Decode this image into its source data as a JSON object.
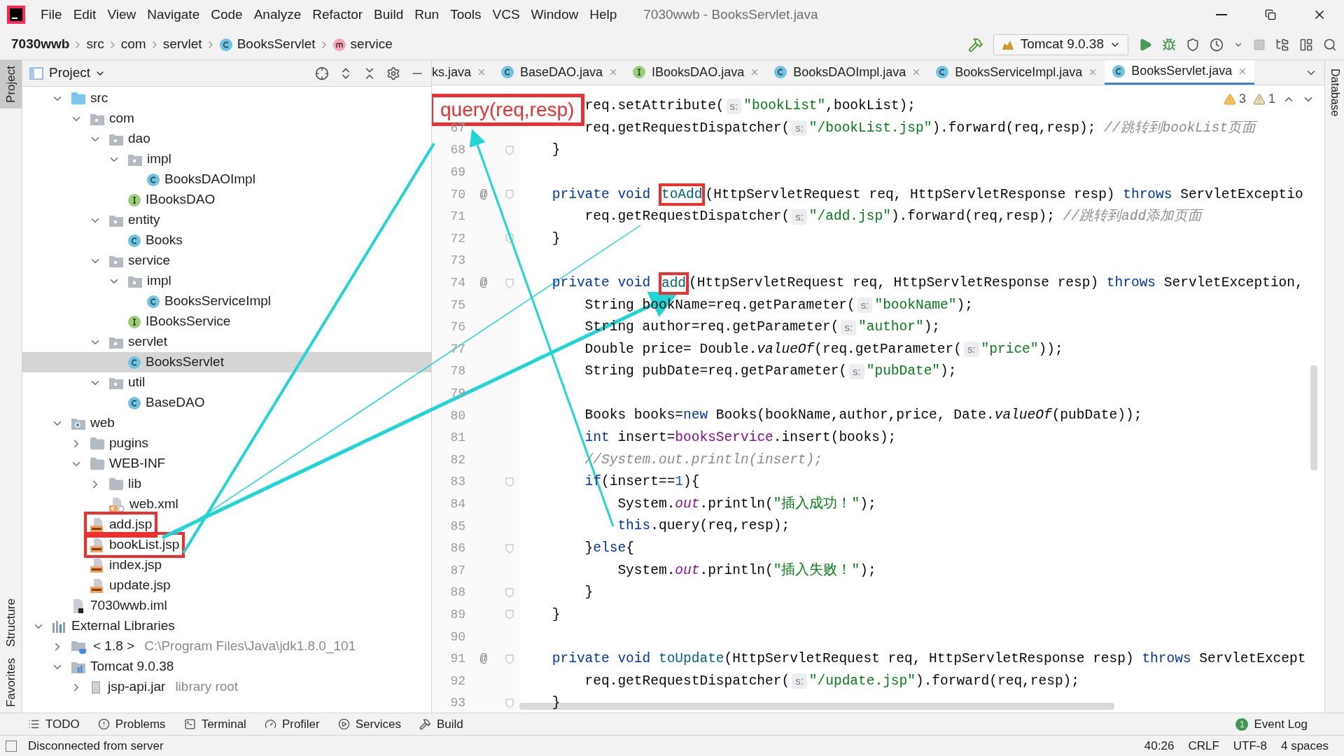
{
  "window": {
    "title": "7030wwb - BooksServlet.java"
  },
  "menu": [
    "File",
    "Edit",
    "View",
    "Navigate",
    "Code",
    "Analyze",
    "Refactor",
    "Build",
    "Run",
    "Tools",
    "VCS",
    "Window",
    "Help"
  ],
  "breadcrumb": [
    {
      "label": "7030wwb",
      "kind": "project"
    },
    {
      "label": "src",
      "kind": "folder"
    },
    {
      "label": "com",
      "kind": "folder"
    },
    {
      "label": "servlet",
      "kind": "folder"
    },
    {
      "label": "BooksServlet",
      "kind": "class"
    },
    {
      "label": "service",
      "kind": "method"
    }
  ],
  "run_config": {
    "label": "Tomcat 9.0.38"
  },
  "side_tabs_left": [
    {
      "label": "Project",
      "selected": true
    },
    {
      "label": "Structure",
      "selected": false
    },
    {
      "label": "Favorites",
      "selected": false
    }
  ],
  "side_tabs_right": [
    {
      "label": "Database",
      "selected": false
    }
  ],
  "project_panel": {
    "title": "Project",
    "root_children": [
      {
        "label": "src",
        "kind": "source-root",
        "expanded": true,
        "selected": false,
        "marked": false,
        "children": [
          {
            "label": "com",
            "kind": "package",
            "expanded": true,
            "selected": false,
            "marked": false,
            "children": [
              {
                "label": "dao",
                "kind": "package",
                "expanded": true,
                "selected": false,
                "marked": false,
                "children": [
                  {
                    "label": "impl",
                    "kind": "package",
                    "expanded": true,
                    "selected": false,
                    "marked": false,
                    "children": [
                      {
                        "label": "BooksDAOImpl",
                        "kind": "class",
                        "selected": false,
                        "marked": false
                      }
                    ]
                  },
                  {
                    "label": "IBooksDAO",
                    "kind": "interface",
                    "selected": false,
                    "marked": false
                  }
                ]
              },
              {
                "label": "entity",
                "kind": "package",
                "expanded": true,
                "selected": false,
                "marked": false,
                "children": [
                  {
                    "label": "Books",
                    "kind": "class",
                    "selected": false,
                    "marked": false
                  }
                ]
              },
              {
                "label": "service",
                "kind": "package",
                "expanded": true,
                "selected": false,
                "marked": false,
                "children": [
                  {
                    "label": "impl",
                    "kind": "package",
                    "expanded": true,
                    "selected": false,
                    "marked": false,
                    "children": [
                      {
                        "label": "BooksServiceImpl",
                        "kind": "class",
                        "selected": false,
                        "marked": false
                      }
                    ]
                  },
                  {
                    "label": "IBooksService",
                    "kind": "interface",
                    "selected": false,
                    "marked": false
                  }
                ]
              },
              {
                "label": "servlet",
                "kind": "package",
                "expanded": true,
                "selected": false,
                "marked": false,
                "children": [
                  {
                    "label": "BooksServlet",
                    "kind": "class",
                    "selected": true,
                    "marked": false
                  }
                ]
              },
              {
                "label": "util",
                "kind": "package",
                "expanded": true,
                "selected": false,
                "marked": false,
                "children": [
                  {
                    "label": "BaseDAO",
                    "kind": "class",
                    "selected": false,
                    "marked": false
                  }
                ]
              }
            ]
          }
        ]
      },
      {
        "label": "web",
        "kind": "web-root",
        "expanded": true,
        "selected": false,
        "marked": false,
        "children": [
          {
            "label": "pugins",
            "kind": "folder",
            "expanded": false,
            "selected": false,
            "marked": false
          },
          {
            "label": "WEB-INF",
            "kind": "folder",
            "expanded": true,
            "selected": false,
            "marked": false,
            "children": [
              {
                "label": "lib",
                "kind": "folder",
                "expanded": false,
                "selected": false,
                "marked": false
              },
              {
                "label": "web.xml",
                "kind": "xml",
                "selected": false,
                "marked": false
              }
            ]
          },
          {
            "label": "add.jsp",
            "kind": "jsp",
            "selected": false,
            "marked": true
          },
          {
            "label": "bookList.jsp",
            "kind": "jsp",
            "selected": false,
            "marked": true
          },
          {
            "label": "index.jsp",
            "kind": "jsp",
            "selected": false,
            "marked": false
          },
          {
            "label": "update.jsp",
            "kind": "jsp",
            "selected": false,
            "marked": false
          }
        ]
      },
      {
        "label": "7030wwb.iml",
        "kind": "iml",
        "selected": false,
        "marked": false
      }
    ],
    "external": [
      {
        "label": "External Libraries",
        "kind": "libraries",
        "expanded": true,
        "selected": false,
        "marked": false,
        "children": [
          {
            "label": "< 1.8 >",
            "detail": "C:\\Program Files\\Java\\jdk1.8.0_101",
            "kind": "jdk",
            "expanded": false,
            "selected": false,
            "marked": false
          },
          {
            "label": "Tomcat 9.0.38",
            "kind": "tomcat",
            "expanded": true,
            "selected": false,
            "marked": false,
            "children": [
              {
                "label": "jsp-api.jar",
                "detail": "library root",
                "kind": "jar",
                "expanded": false,
                "selected": false,
                "marked": false
              }
            ]
          }
        ]
      }
    ]
  },
  "tabs": [
    {
      "label": "ks.java",
      "selected": false
    },
    {
      "label": "BaseDAO.java",
      "kind": "class",
      "selected": false
    },
    {
      "label": "IBooksDAO.java",
      "kind": "interface",
      "selected": false
    },
    {
      "label": "BooksDAOImpl.java",
      "kind": "class",
      "selected": false
    },
    {
      "label": "BooksServiceImpl.java",
      "kind": "class",
      "selected": false
    },
    {
      "label": "BooksServlet.java",
      "kind": "class",
      "selected": true
    }
  ],
  "inspections": {
    "warnings": "3",
    "weak_warnings": "1"
  },
  "code": {
    "lines": [
      {
        "tokens": [
          {
            "kind": "plain",
            "t": "        req.setAttribute("
          },
          {
            "kind": "hint",
            "t": "s:"
          },
          {
            "kind": "string",
            "t": "\"bookList\""
          },
          {
            "kind": "plain",
            "t": ",bookList);"
          }
        ]
      },
      {
        "number": "67",
        "tokens": [
          {
            "kind": "plain",
            "t": "        req.getRequestDispatcher("
          },
          {
            "kind": "hint",
            "t": "s:"
          },
          {
            "kind": "string",
            "t": "\"/bookList.jsp\""
          },
          {
            "kind": "plain",
            "t": ").forward(req,resp); "
          },
          {
            "kind": "comment",
            "t": "//跳转到bookList页面"
          }
        ]
      },
      {
        "number": "68",
        "fold": true,
        "tokens": [
          {
            "kind": "plain",
            "t": "    }"
          }
        ]
      },
      {
        "number": "69"
      },
      {
        "number": "70",
        "marker": "@",
        "fold": true,
        "tokens": [
          {
            "kind": "keyword",
            "t": "    private void "
          },
          {
            "kind": "declaration",
            "t": "toAdd",
            "boxed": true
          },
          {
            "kind": "plain",
            "t": "(HttpServletRequest req, HttpServletResponse resp) "
          },
          {
            "kind": "keyword",
            "t": "throws"
          },
          {
            "kind": "plain",
            "t": " ServletExceptio"
          }
        ]
      },
      {
        "number": "71",
        "tokens": [
          {
            "kind": "plain",
            "t": "        req.getRequestDispatcher("
          },
          {
            "kind": "hint",
            "t": "s:"
          },
          {
            "kind": "string",
            "t": "\"/add.jsp\""
          },
          {
            "kind": "plain",
            "t": ").forward(req,resp); "
          },
          {
            "kind": "comment",
            "t": "//跳转到add添加页面"
          }
        ]
      },
      {
        "number": "72",
        "fold": true,
        "tokens": [
          {
            "kind": "plain",
            "t": "    }"
          }
        ]
      },
      {
        "number": "73"
      },
      {
        "number": "74",
        "marker": "@",
        "fold": true,
        "tokens": [
          {
            "kind": "keyword",
            "t": "    private void "
          },
          {
            "kind": "declaration",
            "t": "add",
            "boxed": true
          },
          {
            "kind": "plain",
            "t": "(HttpServletRequest req, HttpServletResponse resp) "
          },
          {
            "kind": "keyword",
            "t": "throws"
          },
          {
            "kind": "plain",
            "t": " ServletException,"
          }
        ]
      },
      {
        "number": "75",
        "tokens": [
          {
            "kind": "plain",
            "t": "        String bookName=req.getParameter("
          },
          {
            "kind": "hint",
            "t": "s:"
          },
          {
            "kind": "string",
            "t": "\"bookName\""
          },
          {
            "kind": "plain",
            "t": ");"
          }
        ]
      },
      {
        "number": "76",
        "tokens": [
          {
            "kind": "plain",
            "t": "        String author=req.getParameter("
          },
          {
            "kind": "hint",
            "t": "s:"
          },
          {
            "kind": "string",
            "t": "\"author\""
          },
          {
            "kind": "plain",
            "t": ");"
          }
        ]
      },
      {
        "number": "77",
        "tokens": [
          {
            "kind": "plain",
            "t": "        Double price= Double."
          },
          {
            "kind": "static-method",
            "t": "valueOf"
          },
          {
            "kind": "plain",
            "t": "(req.getParameter("
          },
          {
            "kind": "hint",
            "t": "s:"
          },
          {
            "kind": "string",
            "t": "\"price\""
          },
          {
            "kind": "plain",
            "t": "));"
          }
        ]
      },
      {
        "number": "78",
        "tokens": [
          {
            "kind": "plain",
            "t": "        String pubDate=req.getParameter("
          },
          {
            "kind": "hint",
            "t": "s:"
          },
          {
            "kind": "string",
            "t": "\"pubDate\""
          },
          {
            "kind": "plain",
            "t": ");"
          }
        ]
      },
      {
        "number": "79"
      },
      {
        "number": "80",
        "tokens": [
          {
            "kind": "plain",
            "t": "        Books books="
          },
          {
            "kind": "keyword",
            "t": "new"
          },
          {
            "kind": "plain",
            "t": " Books(bookName,author,price, Date."
          },
          {
            "kind": "static-method",
            "t": "valueOf"
          },
          {
            "kind": "plain",
            "t": "(pubDate));"
          }
        ]
      },
      {
        "number": "81",
        "tokens": [
          {
            "kind": "keyword",
            "t": "        int"
          },
          {
            "kind": "plain",
            "t": " insert="
          },
          {
            "kind": "field",
            "t": "booksService"
          },
          {
            "kind": "plain",
            "t": ".insert(books);"
          }
        ]
      },
      {
        "number": "82",
        "tokens": [
          {
            "kind": "comment",
            "t": "        //System.out.println(insert);"
          }
        ]
      },
      {
        "number": "83",
        "fold": true,
        "tokens": [
          {
            "kind": "keyword",
            "t": "        if"
          },
          {
            "kind": "plain",
            "t": "(insert=="
          },
          {
            "kind": "number",
            "t": "1"
          },
          {
            "kind": "plain",
            "t": "){"
          }
        ]
      },
      {
        "number": "84",
        "tokens": [
          {
            "kind": "plain",
            "t": "            System."
          },
          {
            "kind": "static-field",
            "t": "out"
          },
          {
            "kind": "plain",
            "t": ".println("
          },
          {
            "kind": "string",
            "t": "\"插入成功！\""
          },
          {
            "kind": "plain",
            "t": ");"
          }
        ]
      },
      {
        "number": "85",
        "tokens": [
          {
            "kind": "keyword",
            "t": "            this"
          },
          {
            "kind": "plain",
            "t": ".query(req,resp);"
          }
        ]
      },
      {
        "number": "86",
        "fold": true,
        "tokens": [
          {
            "kind": "plain",
            "t": "        }"
          },
          {
            "kind": "keyword",
            "t": "else"
          },
          {
            "kind": "plain",
            "t": "{"
          }
        ]
      },
      {
        "number": "87",
        "tokens": [
          {
            "kind": "plain",
            "t": "            System."
          },
          {
            "kind": "static-field",
            "t": "out"
          },
          {
            "kind": "plain",
            "t": ".println("
          },
          {
            "kind": "string",
            "t": "\"插入失败！\""
          },
          {
            "kind": "plain",
            "t": ");"
          }
        ]
      },
      {
        "number": "88",
        "fold": true,
        "tokens": [
          {
            "kind": "plain",
            "t": "        }"
          }
        ]
      },
      {
        "number": "89",
        "fold": true,
        "tokens": [
          {
            "kind": "plain",
            "t": "    }"
          }
        ]
      },
      {
        "number": "90"
      },
      {
        "number": "91",
        "marker": "@",
        "fold": true,
        "tokens": [
          {
            "kind": "keyword",
            "t": "    private void "
          },
          {
            "kind": "declaration",
            "t": "toUpdate"
          },
          {
            "kind": "plain",
            "t": "(HttpServletRequest req, HttpServletResponse resp) "
          },
          {
            "kind": "keyword",
            "t": "throws"
          },
          {
            "kind": "plain",
            "t": " ServletExcept"
          }
        ]
      },
      {
        "number": "92",
        "tokens": [
          {
            "kind": "plain",
            "t": "        req.getRequestDispatcher("
          },
          {
            "kind": "hint",
            "t": "s:"
          },
          {
            "kind": "string",
            "t": "\"/update.jsp\""
          },
          {
            "kind": "plain",
            "t": ").forward(req,resp);"
          }
        ]
      },
      {
        "number": "93",
        "fold": true,
        "tokens": [
          {
            "kind": "plain",
            "t": "    }"
          }
        ]
      }
    ]
  },
  "annotation": {
    "label": "query(req,resp)"
  },
  "tool_windows": [
    {
      "label": "TODO",
      "kind": "todo"
    },
    {
      "label": "Problems",
      "kind": "problems"
    },
    {
      "label": "Terminal",
      "kind": "terminal"
    },
    {
      "label": "Profiler",
      "kind": "profiler"
    },
    {
      "label": "Services",
      "kind": "services"
    },
    {
      "label": "Build",
      "kind": "build"
    }
  ],
  "event_log": {
    "label": "Event Log",
    "badge": "1"
  },
  "status_bar": {
    "message": "Disconnected from server",
    "position": "40:26",
    "line_separator": "CRLF",
    "encoding": "UTF-8",
    "indent": "4 spaces"
  }
}
